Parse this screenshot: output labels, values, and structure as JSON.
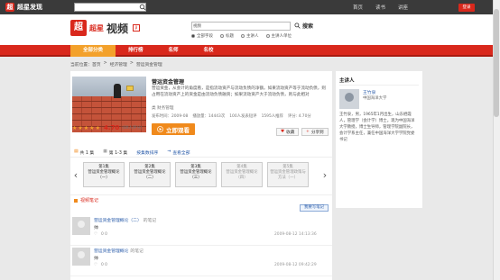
{
  "topbar": {
    "logo_text": "超星发现",
    "search_placeholder": "",
    "links": [
      "首页",
      "读书",
      "讲座"
    ],
    "login_label": "登录"
  },
  "header": {
    "brand_small": "超星",
    "brand_big": "视频",
    "search_scope": "视频",
    "search_value": "",
    "search_label": "搜索",
    "radios": [
      "全部字段",
      "标题",
      "主讲人",
      "主讲人单位"
    ],
    "radio_selected": 0
  },
  "nav": {
    "items": [
      "全部分类",
      "排行榜",
      "名师",
      "名校"
    ]
  },
  "breadcrumb": [
    "当前位置：首页",
    ">",
    "经济管理",
    ">",
    "营运资金管理"
  ],
  "video": {
    "title": "营运资金管理",
    "description": "营运资金，从会计的角度看，是指流动资产与流动负债的净额。如果流动资产等于流动负债，则占用在流动资产上的资金是由流动负债融资；如果流动资产大于流动负债，则与此相对",
    "category": "类 财务管理",
    "meta": [
      "发布时间：2009-08",
      "播放量：14443次",
      "100人发表短评",
      "1595人推荐",
      "评分: 4.70分"
    ],
    "score": "4.70",
    "raters": "(89人评分)",
    "play_label": "立即观看",
    "collect_label": "收藏",
    "share_label": "分享到"
  },
  "tabs": [
    "共 1 集",
    "第 1-3 集",
    "按集数排序",
    "查看全部"
  ],
  "chapters": [
    {
      "line1": "第1集",
      "line2": "营运资金管理概论",
      "line3": "（一）"
    },
    {
      "line1": "第2集",
      "line2": "营运资金管理概论",
      "line3": "（二）"
    },
    {
      "line1": "第3集",
      "line2": "营运资金管理概论",
      "line3": "（三）"
    },
    {
      "line1": "第4集",
      "line2": "营运资金管理概论",
      "line3": "（四）"
    },
    {
      "line1": "第5集",
      "line2": "营运资金管理政策与",
      "line3": "方法（一）"
    }
  ],
  "notes": {
    "heading": "视频笔记",
    "add_label": "我要写笔记",
    "items": [
      {
        "title": "营运资金管理概论（二）",
        "suffix": "的笔记",
        "who": "帅",
        "icons": "0  0",
        "time": "2009-08-12 14:13:36"
      },
      {
        "title": "营运资金管理概论",
        "suffix": "的笔记",
        "who": "帅",
        "icons": "0  0",
        "time": "2009-08-12 09:42:29"
      }
    ]
  },
  "sidebar": {
    "heading": "主讲人",
    "name": "王竹泉",
    "org": "中国海洋大学",
    "bio": "王竹泉，男，1965年1月出生，山东栖霞人，管理学（会计学）博士。现为中国海洋大学教授，博士生导师，管理学院副院长，会计学系主任，兼任中国海洋大学学院党委书记"
  },
  "colors": {
    "brand_red": "#d9281c",
    "accent_orange": "#f08a1c",
    "link_blue": "#2a5caa"
  }
}
